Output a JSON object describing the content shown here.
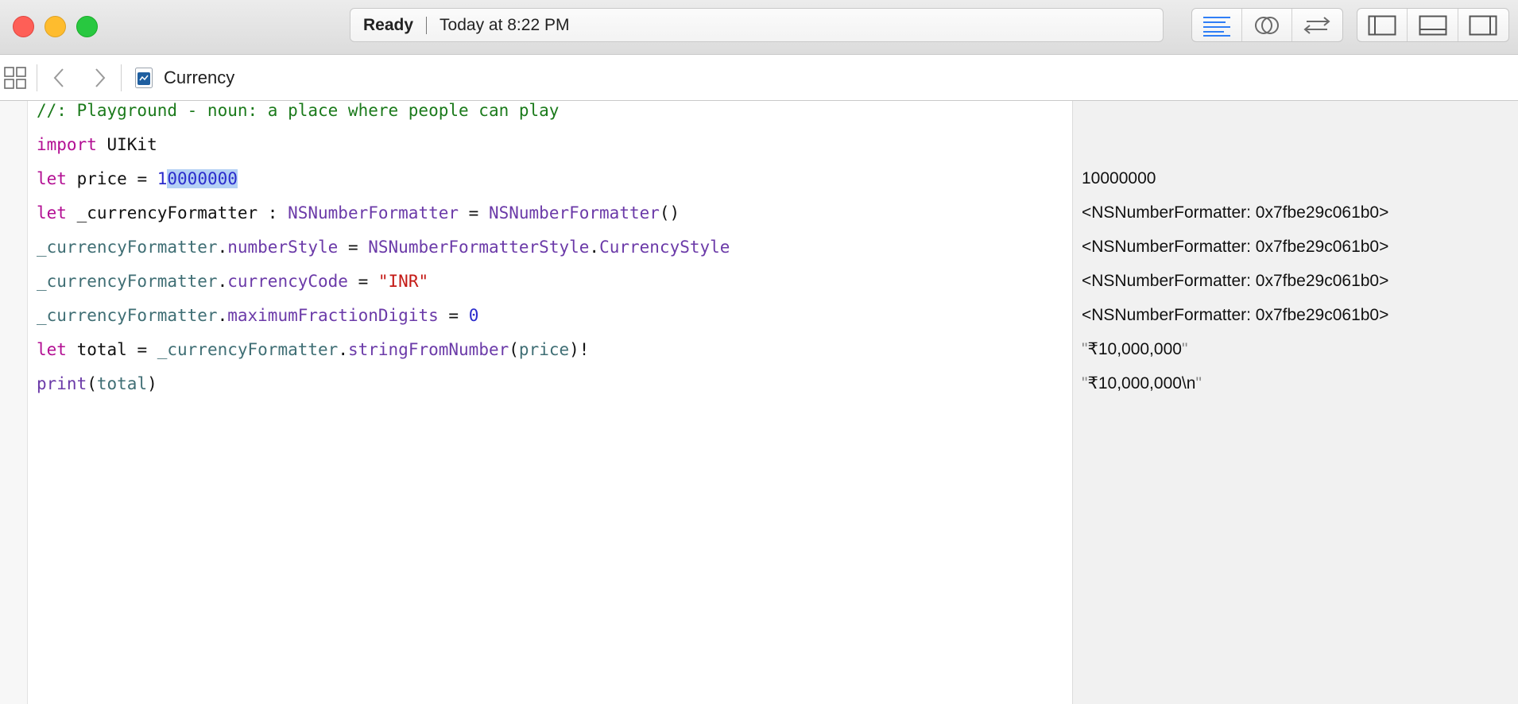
{
  "titlebar": {
    "status": "Ready",
    "time": "Today at 8:22 PM"
  },
  "toolbar": {
    "editor_buttons": [
      "standard-editor-icon",
      "assistant-editor-icon",
      "version-editor-icon"
    ],
    "panel_buttons": [
      "navigator-toggle-icon",
      "debug-area-toggle-icon",
      "utilities-toggle-icon"
    ]
  },
  "jumpbar": {
    "file_name": "Currency"
  },
  "code": {
    "line1": {
      "text": "//: Playground - noun: a place where people can play"
    },
    "line2": {
      "kw": "import",
      "rest": " UIKit"
    },
    "line3": {
      "kw": "let",
      "rest": " price = ",
      "num_a": "1",
      "num_sel": "0000000"
    },
    "line4": {
      "kw": "let",
      "rest": " _currencyFormatter : ",
      "type1": "NSNumberFormatter",
      "eq": " = ",
      "type2": "NSNumberFormatter",
      "tail": "()"
    },
    "line5": {
      "var": "_currencyFormatter",
      "dot": ".",
      "prop": "numberStyle",
      "eq": " = ",
      "type": "NSNumberFormatterStyle",
      "dot2": ".",
      "member": "CurrencyStyle"
    },
    "line6": {
      "var": "_currencyFormatter",
      "dot": ".",
      "prop": "currencyCode",
      "eq": " = ",
      "str": "\"INR\""
    },
    "line7": {
      "var": "_currencyFormatter",
      "dot": ".",
      "prop": "maximumFractionDigits",
      "eq": " = ",
      "num": "0"
    },
    "line8": {
      "kw": "let",
      "rest": " total = ",
      "var": "_currencyFormatter",
      "dot": ".",
      "method": "stringFromNumber",
      "open": "(",
      "arg": "price",
      "close": ")!"
    },
    "line9": {
      "fn": "print",
      "open": "(",
      "arg": "total",
      "close": ")"
    }
  },
  "results": {
    "line3": "10000000",
    "line4": "<NSNumberFormatter: 0x7fbe29c061b0>",
    "line5": "<NSNumberFormatter: 0x7fbe29c061b0>",
    "line6": "<NSNumberFormatter: 0x7fbe29c061b0>",
    "line7": "<NSNumberFormatter: 0x7fbe29c061b0>",
    "line8": {
      "q1": "\"",
      "value": "₹10,000,000",
      "q2": "\""
    },
    "line9": {
      "q1": "\"",
      "value": "₹10,000,000\\n",
      "q2": "\""
    }
  }
}
